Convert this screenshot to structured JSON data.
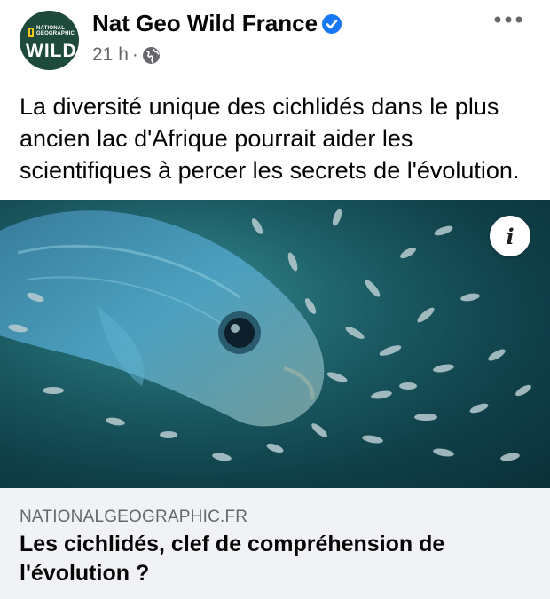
{
  "post": {
    "author": "Nat Geo Wild France",
    "avatar_small_text": "NATIONAL GEOGRAPHIC",
    "avatar_main_text": "WILD",
    "time": "21 h",
    "separator": "·",
    "text": "La diversité unique des cichlidés dans le plus ancien lac d'Afrique pourrait aider les scientifiques à percer les secrets de l'évolution."
  },
  "icons": {
    "verified": "verified-badge-icon",
    "privacy": "globe-icon",
    "more": "more-options-icon",
    "info": "info-icon"
  },
  "colors": {
    "verified_blue": "#1877f2",
    "meta_gray": "#65676b",
    "link_bg": "#f0f2f5"
  },
  "link_preview": {
    "info_label": "i",
    "domain": "NATIONALGEOGRAPHIC.FR",
    "title": "Les cichlidés, clef de compréhension de l'évolution ?"
  }
}
